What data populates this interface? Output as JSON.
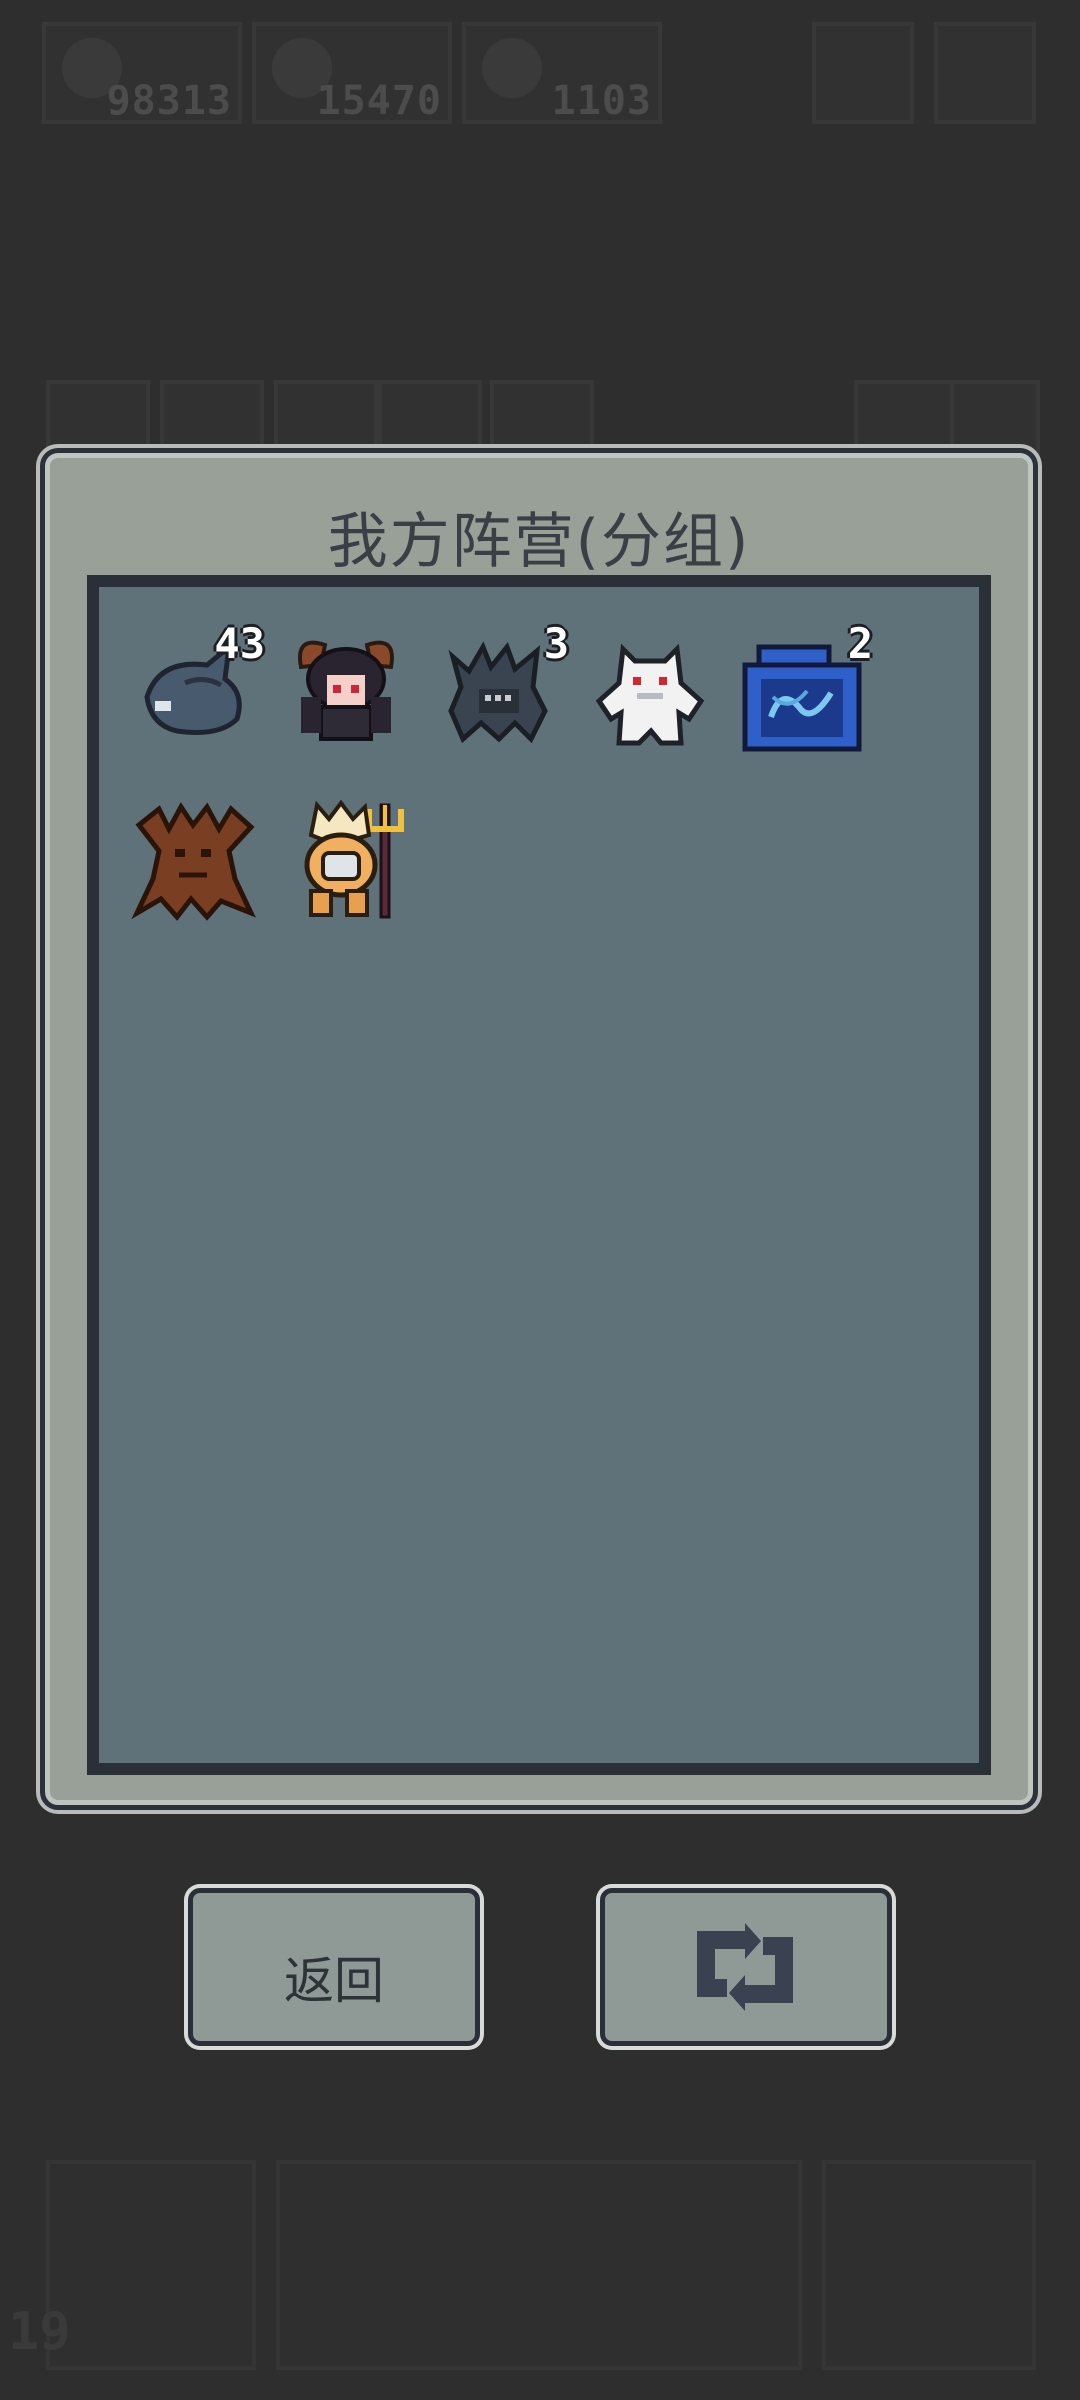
{
  "hud": {
    "resources": [
      {
        "name": "sword-icon",
        "value": "98313"
      },
      {
        "name": "bag-icon",
        "value": "15470"
      },
      {
        "name": "gear-icon",
        "value": "1103"
      }
    ],
    "level": "19"
  },
  "panel": {
    "title": "我方阵营(分组)",
    "units": [
      {
        "name": "dark-whale-unit",
        "count": "43",
        "color": "#4a5a6c"
      },
      {
        "name": "horned-girl-unit",
        "count": "",
        "color": "#3a2a2e"
      },
      {
        "name": "shadow-beast-unit",
        "count": "3",
        "color": "#384250"
      },
      {
        "name": "white-ghost-unit",
        "count": "",
        "color": "#f2f2f2"
      },
      {
        "name": "blue-shrine-unit",
        "count": "2",
        "color": "#2f5fc8"
      },
      {
        "name": "tree-ent-unit",
        "count": "",
        "color": "#7a3f22"
      },
      {
        "name": "golden-knight-unit",
        "count": "",
        "color": "#e8b060"
      }
    ]
  },
  "buttons": {
    "back_label": "返回",
    "refresh_icon": "refresh-icon"
  }
}
